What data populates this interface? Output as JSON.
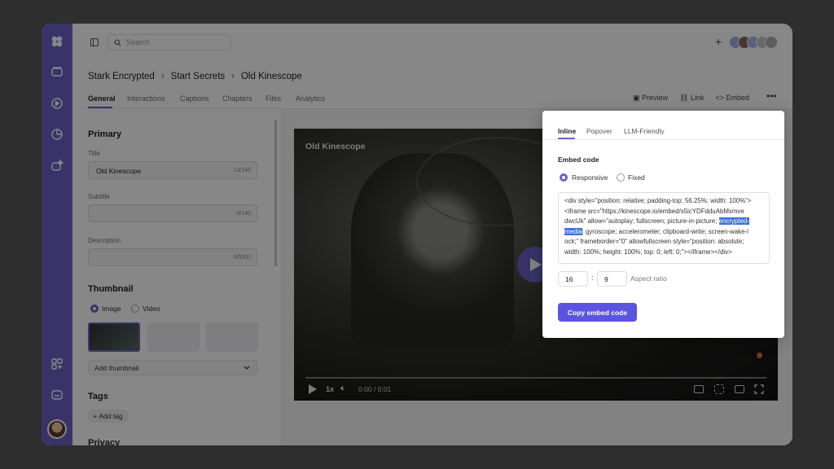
{
  "search": {
    "placeholder": "Search"
  },
  "breadcrumb": {
    "items": [
      "Stark Encrypted",
      "Start Secrets",
      "Old Kinescope"
    ],
    "sep": "›"
  },
  "tabs": [
    "General",
    "Interactions",
    "Captions",
    "Chapters",
    "Files",
    "Analytics"
  ],
  "actions": {
    "preview": "Preview",
    "link": "Link",
    "embed": "Embed"
  },
  "form": {
    "primary": "Primary",
    "title_label": "Title",
    "title_value": "Old Kinescope",
    "title_count": "13/140",
    "subtitle_label": "Subtitle",
    "subtitle_count": "0/140",
    "description_label": "Description",
    "description_count": "0/5000",
    "thumbnail": "Thumbnail",
    "thumb_image": "Image",
    "thumb_video": "Video",
    "add_thumbnail": "Add thumbnail",
    "tags": "Tags",
    "add_tag": "Add tag",
    "privacy": "Privacy"
  },
  "video": {
    "overlay_title": "Old Kinescope",
    "speed": "1x",
    "time": "0:00 / 0:01"
  },
  "embed": {
    "tabs": [
      "Inline",
      "Popover",
      "LLM-Friendly"
    ],
    "code_label": "Embed code",
    "responsive": "Responsive",
    "fixed": "Fixed",
    "code_lines": [
      "<div style=\"position: relative; padding-top: 56.25%; width: 100%\">",
      "<iframe src=\"https://kinescope.io/embed/s5icYDFdduAbMxmve",
      "dwcUk\" allow=\"autoplay; fullscreen; picture-in-picture; "
    ],
    "code_hl1": "encrypted-",
    "code_hl2": "media",
    "code_line4_rest": "; gyroscope; accelerometer; clipboard-write; screen-wake-l",
    "code_line5": "ock;\" frameborder=\"0\" allowfullscreen style=\"position: absolute;",
    "code_line6": "width: 100%; height: 100%; top: 0; left: 0;\"></iframe></div>",
    "ratio_w": "16",
    "ratio_sep": ":",
    "ratio_h": "9",
    "ratio_label": "Aspect ratio",
    "copy_button": "Copy embed code"
  },
  "colors": {
    "accent": "#6b62c8",
    "button": "#5b54e0",
    "highlight": "#3a6fd6"
  }
}
